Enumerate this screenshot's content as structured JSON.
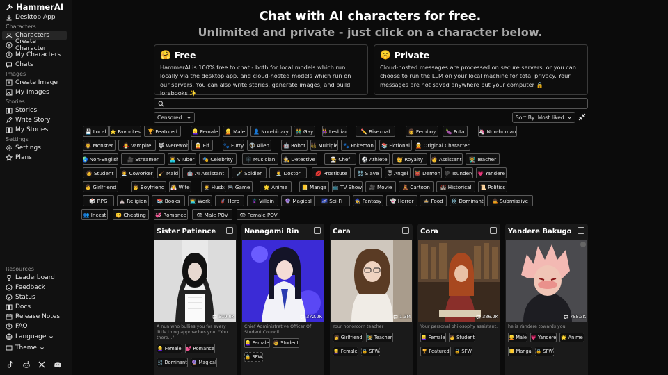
{
  "brand": {
    "name": "HammerAI"
  },
  "sidebar": {
    "desktop_app": "Desktop App",
    "sections": {
      "characters": "Characters",
      "images": "Images",
      "stories": "Stories",
      "settings": "Settings",
      "resources": "Resources"
    },
    "items": {
      "characters": "Characters",
      "create_character": "Create Character",
      "my_characters": "My Characters",
      "chats": "Chats",
      "create_image": "Create Image",
      "my_images": "My Images",
      "stories": "Stories",
      "write_story": "Write Story",
      "my_stories": "My Stories",
      "settings": "Settings",
      "plans": "Plans",
      "leaderboard": "Leaderboard",
      "feedback": "Feedback",
      "status": "Status",
      "docs": "Docs",
      "release_notes": "Release Notes",
      "faq": "FAQ",
      "language": "Language",
      "theme": "Theme"
    }
  },
  "hero": {
    "title": "Chat with AI characters for free.",
    "subtitle": "Unlimited and private - just click on a character below."
  },
  "free_box": {
    "emoji": "🤗",
    "title": "Free",
    "text": "HammerAI is 100% free to chat - both for local models which run locally via the desktop app, and cloud-hosted models which run on our servers. You can also write stories, generate images, and build lorebooks ✨"
  },
  "private_box": {
    "emoji": "🤫",
    "title": "Private",
    "text": "Cloud-hosted messages are processed on secure servers, or you can choose to run the LLM on your local machine for total privacy. Your messages are not saved anywhere but your computer 🔒"
  },
  "filters": {
    "censored": "Censored",
    "sort": "Sort By: Most liked"
  },
  "tags": [
    [
      "💾 Local",
      "⭐ Favorites",
      "🏆 Featured",
      "👱‍♀️ Female",
      "👱 Male",
      "👤 Non-binary",
      "👬 Gay",
      "👭 Lesbian",
      "✏️ Bisexual",
      "👩 Femboy",
      "🍆 Futa",
      "🦄 Non-human"
    ],
    [
      "🧛 Monster",
      "🧛 Vampire",
      "🐺 Werewolf",
      "🧝 Elf",
      "🐾 Furry",
      "👽 Alien",
      "🤖 Robot",
      "👯 Multiple",
      "🐾 Pokemon",
      "📚 Fictional",
      "🧝 Original Character"
    ],
    [
      "🌏 Non-English",
      "🎥 Streamer",
      "👩‍💻 VTuber",
      "🎭 Celebrity",
      "🎼 Musician",
      "🕵️ Detective",
      "👨‍🍳 Chef",
      "⚽ Athlete",
      "👑 Royalty",
      "🧑 Assistant",
      "👨‍🏫 Teacher"
    ],
    [
      "🧑 Student",
      "👩‍💼 Coworker",
      "🧹 Maid",
      "🤖 AI Assistant",
      "🗡️ Soldier",
      "👨‍⚕️ Doctor",
      "💋 Prostitute",
      "⛓️ Slave",
      "😇 Angel",
      "👹 Demon",
      "🖤 Tsundere",
      "💗 Yandere"
    ],
    [
      "👩 Girlfriend",
      "👨 Boyfriend",
      "👰 Wife",
      "🤵 Husband",
      "🎮 Game",
      "🌟 Anime",
      "📒 Manga",
      "📺 TV Show",
      "🎥 Movie",
      "🧸 Cartoon",
      "🏰 Historical",
      "📜 Politics"
    ],
    [
      "🎲 RPG",
      "⛪ Religion",
      "📚 Books",
      "👨‍💻 Work",
      "🦸 Hero",
      "🦹 Villain",
      "🔮 Magical",
      "🌌 Sci-Fi",
      "🧙 Fantasy",
      "👻 Horror",
      "🍲 Food",
      "⛓️ Dominant",
      "🙇 Submissive"
    ],
    [
      "👥 Incest",
      "🤫 Cheating",
      "💞 Romance",
      "👁 Male POV",
      "👁 Female POV"
    ]
  ],
  "cards": [
    {
      "name": "Sister Patience",
      "count": "519.9K",
      "desc": "A nun who bullies you for every little thing approaches you. \"You there...\"",
      "tags": [
        "👱‍♀️ Female",
        "💕 Romance",
        "⛓️ Dominant",
        "🔮 Magical"
      ]
    },
    {
      "name": "Nanagami Rin",
      "count": "372.2K",
      "desc": "Chief Administrative Officer Of Student Council",
      "tags": [
        "👱‍♀️ Female",
        "🧑 Student",
        "🔒 SFW"
      ]
    },
    {
      "name": "Cara",
      "count": "1.3M",
      "desc": "Your honorcom teacher",
      "tags": [
        "👩 Girlfriend",
        "👨‍🏫 Teacher",
        "👱‍♀️ Female",
        "🔒 SFW"
      ]
    },
    {
      "name": "Cora",
      "count": "386.2K",
      "desc": "Your personal philosophy assistant.",
      "tags": [
        "👱‍♀️ Female",
        "🧑 Student",
        "🏆 Featured",
        "🔒 SFW"
      ]
    },
    {
      "name": "Yandere Bakugo",
      "count": "755.3K",
      "desc": "he is Yandere towards you",
      "tags": [
        "👱 Male",
        "💗 Yandere",
        "🌟 Anime",
        "📒 Manga",
        "🔒 SFW"
      ]
    }
  ]
}
